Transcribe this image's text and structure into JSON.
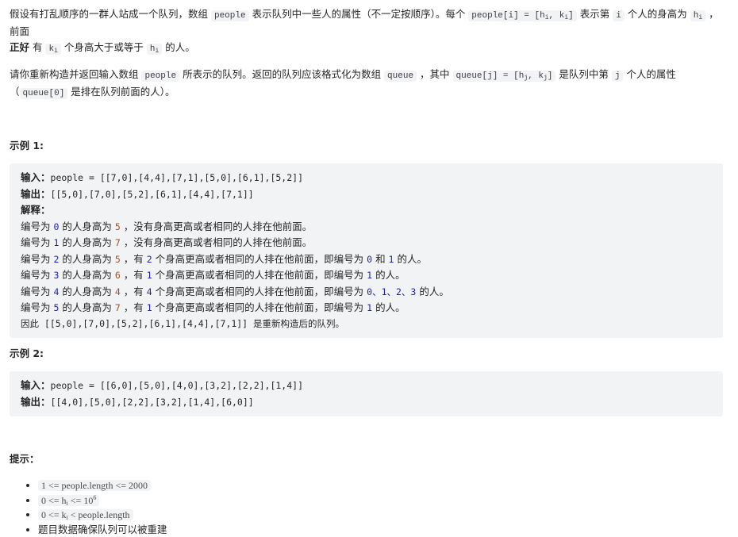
{
  "description": {
    "p1": {
      "t1": "假设有打乱顺序的一群人站成一个队列，数组 ",
      "c1": "people",
      "t2": " 表示队列中一些人的属性（不一定按顺序）。每个 ",
      "c2_pre": "people[i] = [h",
      "c2_sub1": "i",
      "c2_mid": ", k",
      "c2_sub2": "i",
      "c2_post": "]",
      "t3": " 表示第 ",
      "c3": "i",
      "t4": " 个人的身高为 ",
      "c4_pre": "h",
      "c4_sub": "i",
      "t5": " ，前面 ",
      "bold": "正好",
      "t6": " 有 ",
      "c5_pre": "k",
      "c5_sub": "i",
      "t7": " 个身高大于或等于 ",
      "c6_pre": "h",
      "c6_sub": "i",
      "t8": " 的人。"
    },
    "p2": {
      "t1": "请你重新构造并返回输入数组 ",
      "c1": "people",
      "t2": " 所表示的队列。返回的队列应该格式化为数组 ",
      "c2": "queue",
      "t3": " ，其中 ",
      "c3_pre": "queue[j] = [h",
      "c3_sub1": "j",
      "c3_mid": ", k",
      "c3_sub2": "j",
      "c3_post": "]",
      "t4": " 是队列中第 ",
      "c4": "j",
      "t5": " 个人的属性（",
      "c5": "queue[0]",
      "t6": " 是排在队列前面的人）。"
    }
  },
  "example1": {
    "title": "示例 1:",
    "input_label": "输入：",
    "input_value": "people = [[7,0],[4,4],[7,1],[5,0],[6,1],[5,2]]",
    "output_label": "输出：",
    "output_value": "[[5,0],[7,0],[5,2],[6,1],[4,4],[7,1]]",
    "explain_label": "解释：",
    "lines": [
      [
        "编号为 ",
        "0",
        " 的人身高为 ",
        "5",
        " ，没有身高更高或者相同的人排在他前面。"
      ],
      [
        "编号为 ",
        "1",
        " 的人身高为 ",
        "7",
        " ，没有身高更高或者相同的人排在他前面。"
      ],
      [
        "编号为 ",
        "2",
        " 的人身高为 ",
        "5",
        " ，有 ",
        "2",
        " 个身高更高或者相同的人排在他前面，即编号为 ",
        "0",
        " 和 ",
        "1",
        " 的人。"
      ],
      [
        "编号为 ",
        "3",
        " 的人身高为 ",
        "6",
        " ，有 ",
        "1",
        " 个身高更高或者相同的人排在他前面，即编号为 ",
        "1",
        " 的人。"
      ],
      [
        "编号为 ",
        "4",
        " 的人身高为 ",
        "4",
        " ，有 ",
        "4",
        " 个身高更高或者相同的人排在他前面，即编号为 ",
        "0、1、2、3",
        " 的人。"
      ],
      [
        "编号为 ",
        "5",
        " 的人身高为 ",
        "7",
        " ，有 ",
        "1",
        " 个身高更高或者相同的人排在他前面，即编号为 ",
        "1",
        " 的人。"
      ]
    ],
    "conclusion_pre": "因此 ",
    "conclusion_value": "[[5,0],[7,0],[5,2],[6,1],[4,4],[7,1]]",
    "conclusion_post": " 是重新构造后的队列。"
  },
  "example2": {
    "title": "示例 2:",
    "input_label": "输入：",
    "input_value": "people = [[6,0],[5,0],[4,0],[3,2],[2,2],[1,4]]",
    "output_label": "输出：",
    "output_value": "[[4,0],[5,0],[2,2],[3,2],[1,4],[6,0]]"
  },
  "hints": {
    "title": "提示：",
    "items": {
      "i1": "1 <= people.length <= 2000",
      "i2_pre": "0 <= h",
      "i2_sub": "i",
      "i2_mid": " <= 10",
      "i2_sup": "6",
      "i3_pre": "0 <= k",
      "i3_sub": "i",
      "i3_post": " < people.length",
      "i4": "题目数据确保队列可以被重建"
    }
  }
}
